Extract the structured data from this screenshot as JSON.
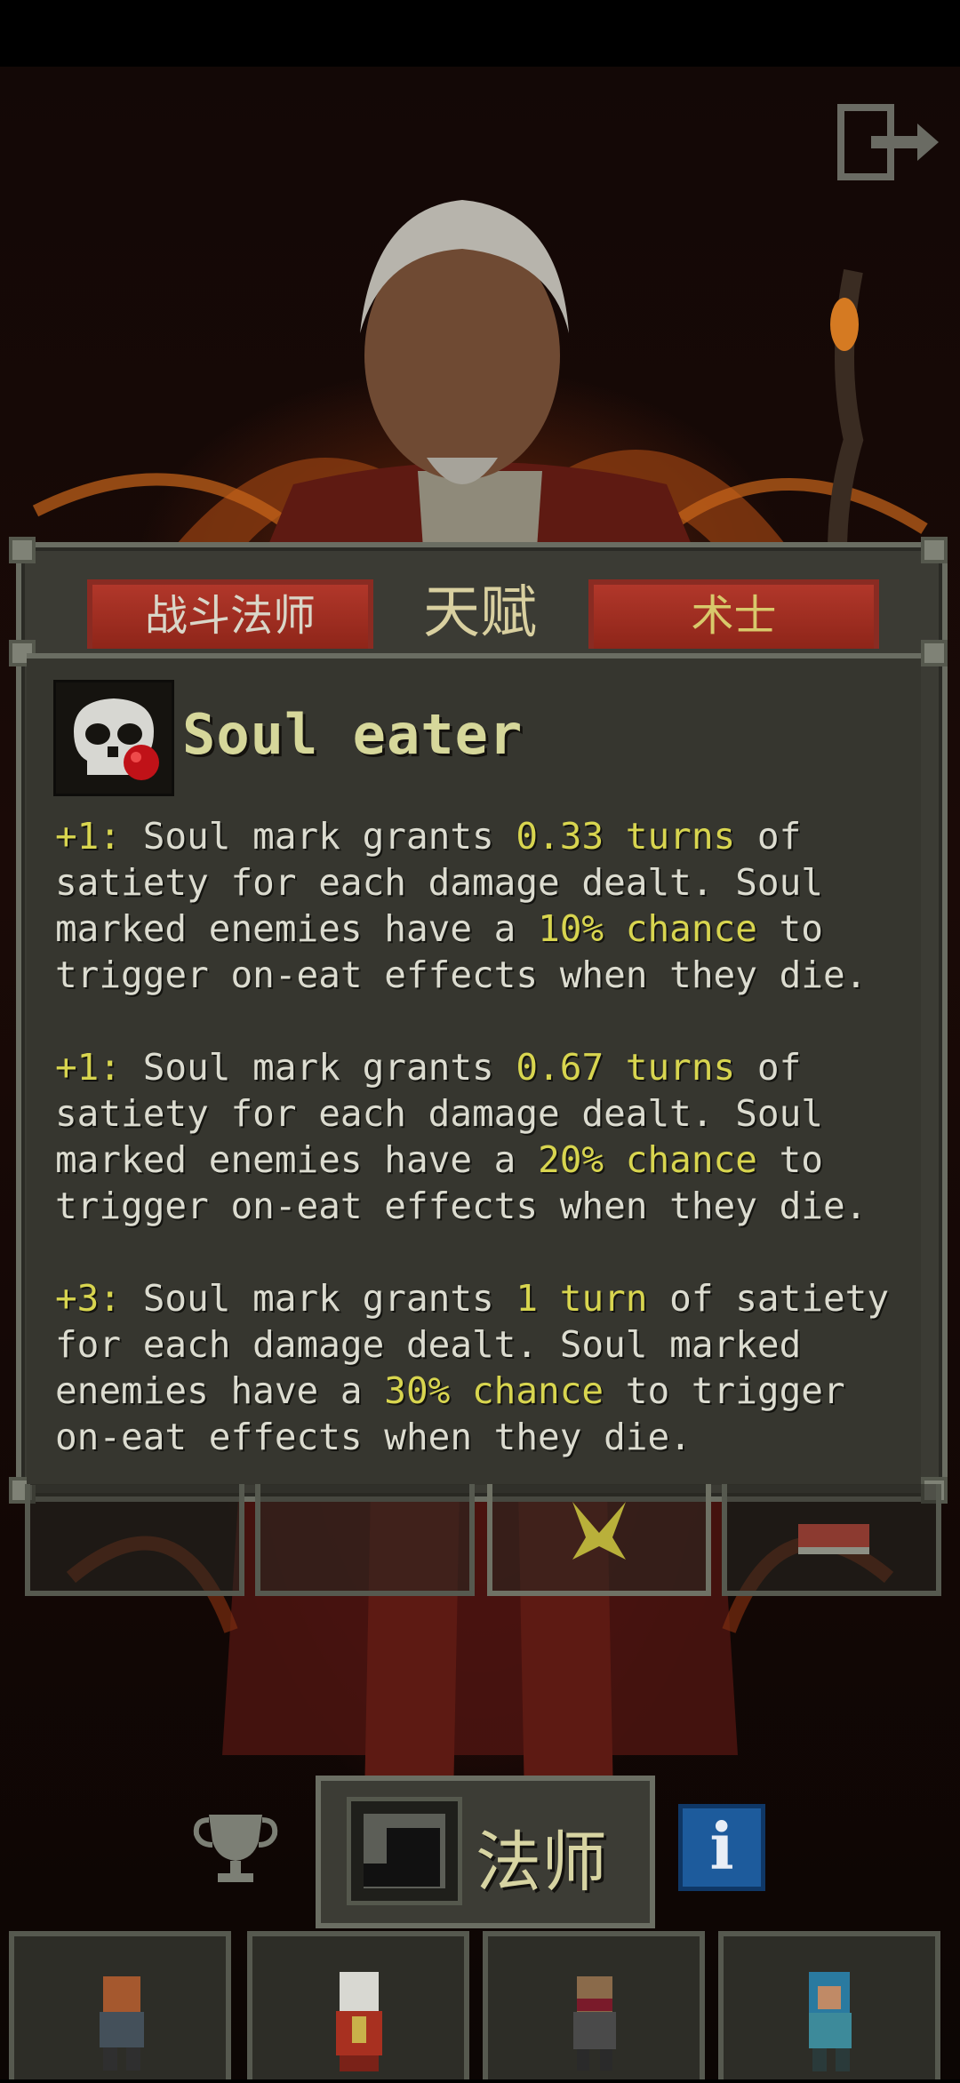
{
  "header": {
    "exit_icon": "exit-icon"
  },
  "tabs": {
    "left_label": "战斗法师",
    "center_label": "天赋",
    "right_label": "术士"
  },
  "talent": {
    "icon": "skull-icon",
    "title": "Soul eater",
    "tiers": [
      {
        "prefix": "+1:",
        "text1": " Soul mark grants ",
        "hl1": "0.33 turns",
        "text2": " of satiety for each damage dealt. Soul marked enemies have a ",
        "hl2": "10% chance",
        "text3": " to trigger on-eat effects when they die."
      },
      {
        "prefix": "+1:",
        "text1": " Soul mark grants ",
        "hl1": "0.67 turns",
        "text2": " of satiety for each damage dealt. Soul marked enemies have a ",
        "hl2": "20% chance",
        "text3": " to trigger on-eat effects when they die."
      },
      {
        "prefix": "+3:",
        "text1": " Soul mark grants ",
        "hl1": "1 turn",
        "text2": " of satiety for each damage dealt. Soul marked enemies have a ",
        "hl2": "30% chance",
        "text3": " to trigger on-eat effects when they die."
      }
    ]
  },
  "class_bar": {
    "trophy_icon": "trophy-icon",
    "class_label": "法师",
    "info_label": "i"
  },
  "heroes": [
    "warrior",
    "mage",
    "rogue",
    "huntress"
  ],
  "colors": {
    "highlight": "#d8d54f",
    "tab_red": "#b1372a",
    "info_blue": "#1d5b9c"
  }
}
